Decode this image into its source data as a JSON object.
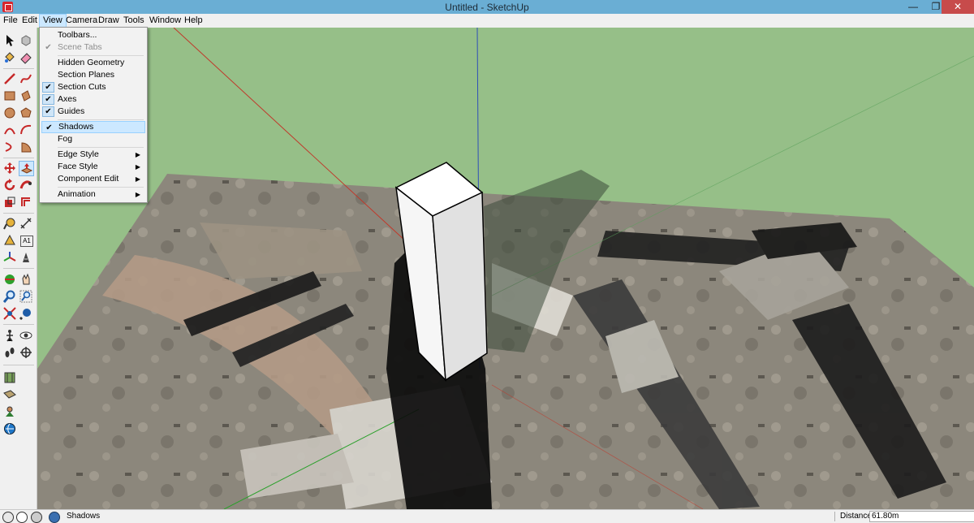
{
  "window": {
    "title": "Untitled - SketchUp",
    "minimize": "—",
    "maximize": "❐",
    "close": "✕"
  },
  "menubar": {
    "items": [
      {
        "label": "File"
      },
      {
        "label": "Edit"
      },
      {
        "label": "View"
      },
      {
        "label": "Camera"
      },
      {
        "label": "Draw"
      },
      {
        "label": "Tools"
      },
      {
        "label": "Window"
      },
      {
        "label": "Help"
      }
    ],
    "active": "View"
  },
  "view_menu": {
    "items": [
      {
        "label": "Toolbars...",
        "checked": false,
        "enabled": true
      },
      {
        "label": "Scene Tabs",
        "checked": true,
        "enabled": false
      },
      {
        "label": "Hidden Geometry",
        "checked": false,
        "enabled": true
      },
      {
        "label": "Section Planes",
        "checked": false,
        "enabled": true
      },
      {
        "label": "Section Cuts",
        "checked": true,
        "enabled": true
      },
      {
        "label": "Axes",
        "checked": true,
        "enabled": true
      },
      {
        "label": "Guides",
        "checked": true,
        "enabled": true
      },
      {
        "label": "Shadows",
        "checked": true,
        "enabled": true,
        "highlighted": true
      },
      {
        "label": "Fog",
        "checked": false,
        "enabled": true
      },
      {
        "label": "Edge Style",
        "submenu": true
      },
      {
        "label": "Face Style",
        "submenu": true
      },
      {
        "label": "Component Edit",
        "submenu": true
      },
      {
        "label": "Animation",
        "submenu": true
      }
    ],
    "check_glyph": "✔",
    "submenu_glyph": "▶"
  },
  "toolbar": {
    "tools": [
      "select-icon",
      "make-component-icon",
      "paint-bucket-icon",
      "eraser-icon",
      "line-icon",
      "freehand-icon",
      "rectangle-icon",
      "rotated-rectangle-icon",
      "circle-icon",
      "polygon-icon",
      "arc-icon",
      "two-point-arc-icon",
      "three-point-arc-icon",
      "pie-icon",
      "move-icon",
      "push-pull-icon",
      "rotate-icon",
      "follow-me-icon",
      "scale-icon",
      "offset-icon",
      "tape-measure-icon",
      "dimension-icon",
      "protractor-icon",
      "text-icon",
      "axes-icon",
      "3d-text-icon",
      "orbit-icon",
      "pan-icon",
      "zoom-icon",
      "zoom-window-icon",
      "zoom-extents-icon",
      "previous-view-icon",
      "position-camera-icon",
      "look-around-icon",
      "walk-icon",
      "section-plane-icon",
      "add-location-icon",
      "toggle-terrain-icon",
      "photo-textures-icon",
      "extension-warehouse-icon"
    ],
    "text_glyphs": {
      "dimension": "A1"
    }
  },
  "statusbar": {
    "icons": [
      "geo-location-icon",
      "credits-icon",
      "user-icon",
      "help-icon"
    ],
    "message": "Shadows",
    "measurement_label": "Distance",
    "measurement_value": "61.80m"
  },
  "scene": {
    "sky_color": "#96bf88",
    "axis_colors": {
      "red": "#c0392b",
      "green": "#2ca02c",
      "blue": "#2f4fb8"
    }
  }
}
